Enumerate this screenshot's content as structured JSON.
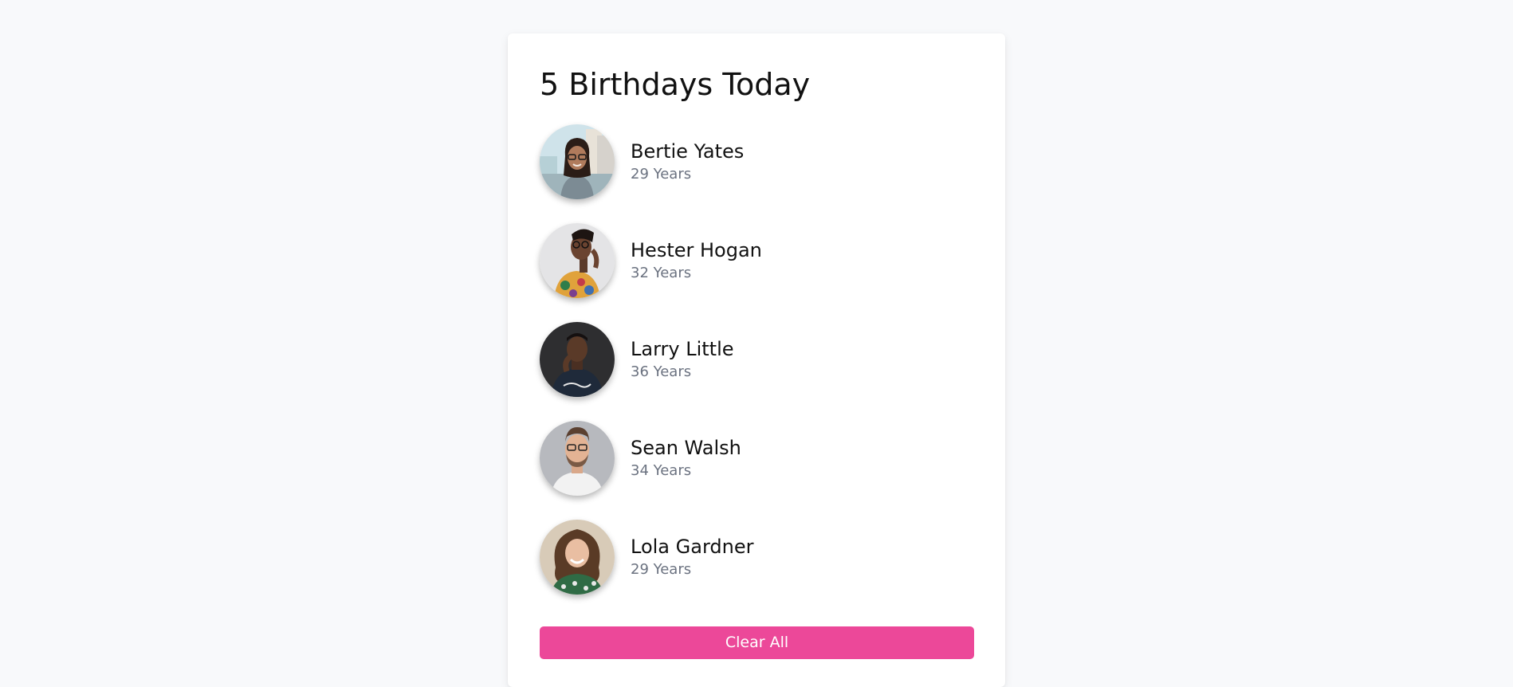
{
  "header": {
    "count": "5",
    "title": "5 Birthdays Today"
  },
  "people": [
    {
      "name": "Bertie Yates",
      "age": "29 Years",
      "avatar_icon": "avatar-photo-woman-glasses-street"
    },
    {
      "name": "Hester Hogan",
      "age": "32 Years",
      "avatar_icon": "avatar-photo-woman-glasses-floral"
    },
    {
      "name": "Larry Little",
      "age": "36 Years",
      "avatar_icon": "avatar-photo-man-dark-shirt"
    },
    {
      "name": "Sean Walsh",
      "age": "34 Years",
      "avatar_icon": "avatar-photo-man-glasses-beard"
    },
    {
      "name": "Lola Gardner",
      "age": "29 Years",
      "avatar_icon": "avatar-photo-woman-curly-hair"
    }
  ],
  "actions": {
    "clear_label": "Clear All"
  },
  "colors": {
    "accent": "#ec4899",
    "page_background": "#f8f9fb",
    "card_background": "#ffffff",
    "name_text": "#111111",
    "age_text": "#6b7280"
  }
}
